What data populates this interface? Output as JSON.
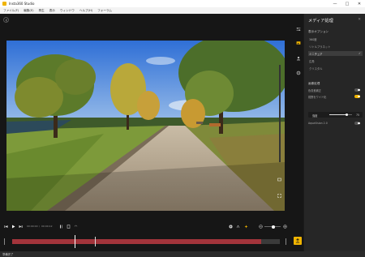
{
  "window": {
    "title": "Insta360 Studio",
    "controls": [
      "—",
      "□",
      "✕"
    ]
  },
  "menu": [
    "ファイル(F)",
    "編集(E)",
    "再生",
    "表示",
    "ウィンドウ",
    "ヘルプ(H)",
    "フォーラム"
  ],
  "playback": {
    "current_time": "00:00:00",
    "total_time": "00:00:12",
    "zoom_value": 0.55
  },
  "timeline": {
    "playhead_fraction": 0.25
  },
  "panel": {
    "title": "メディア処理",
    "section1_title": "表示オプション",
    "options": [
      {
        "label": "360度",
        "selected": false
      },
      {
        "label": "リトルプラネット",
        "selected": false
      },
      {
        "label": "ミニチュア",
        "selected": true
      },
      {
        "label": "広角",
        "selected": false
      },
      {
        "label": "クリスタル",
        "selected": false
      }
    ],
    "section2_title": "画像処理",
    "toggle1_label": "色収差補正",
    "toggle1_on": false,
    "toggle2_label": "視野をワイド化",
    "toggle2_on": true,
    "slider_label": "強度",
    "slider_value_text": "75",
    "slider_fraction": 0.75,
    "toggle3_label": "AquaVision 2.0",
    "toggle3_on": false
  },
  "status": {
    "text": "準備完了"
  },
  "colors": {
    "accent": "#f0b400",
    "track": "#a3343b",
    "panel_bg": "#262626",
    "viewer_bg": "#161616"
  },
  "icons": {
    "back": "chevron-left-icon",
    "rail": [
      "sliders-icon",
      "image-icon",
      "people-icon",
      "gear-icon"
    ],
    "overlay": [
      "ratio-icon",
      "fullscreen-icon"
    ],
    "export": "export-icon"
  }
}
